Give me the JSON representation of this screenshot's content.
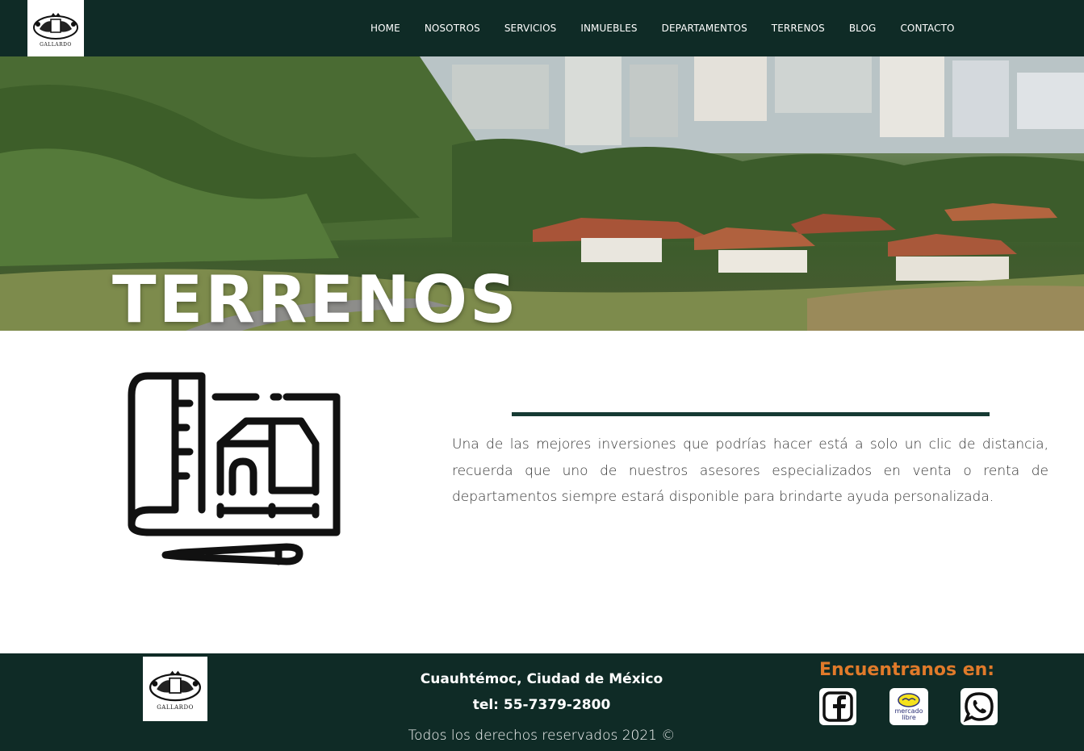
{
  "site": {
    "logo_text": "GALLARDO"
  },
  "nav": {
    "items": [
      {
        "label": "HOME"
      },
      {
        "label": "NOSOTROS"
      },
      {
        "label": "SERVICIOS"
      },
      {
        "label": "INMUEBLES"
      },
      {
        "label": "DEPARTAMENTOS"
      },
      {
        "label": "TERRENOS"
      },
      {
        "label": "BLOG"
      },
      {
        "label": "CONTACTO"
      }
    ]
  },
  "hero": {
    "title": "TERRENOS"
  },
  "main": {
    "icon": "blueprint-house-icon",
    "description": "Una de las mejores inversiones que podrías hacer está a solo un clic de distancia, recuerda que uno de nuestros asesores especializados en venta o renta de departamentos siempre estará disponible para brindarte ayuda personalizada."
  },
  "footer": {
    "logo_text": "GALLARDO",
    "address": "Cuauhtémoc, Ciudad de México",
    "phone": "tel: 55-7379-2800",
    "copyright": "Todos los derechos reservados 2021 ©",
    "find_us": "Encuentranos en:",
    "social": [
      {
        "icon": "facebook-icon"
      },
      {
        "icon": "mercado-libre-icon",
        "label": "mercado libre"
      },
      {
        "icon": "whatsapp-icon"
      }
    ]
  },
  "colors": {
    "nav_bg": "#0f2b26",
    "footer_bg": "#0f2b26",
    "accent_orange": "#e07a2a",
    "divider": "#163a33"
  }
}
